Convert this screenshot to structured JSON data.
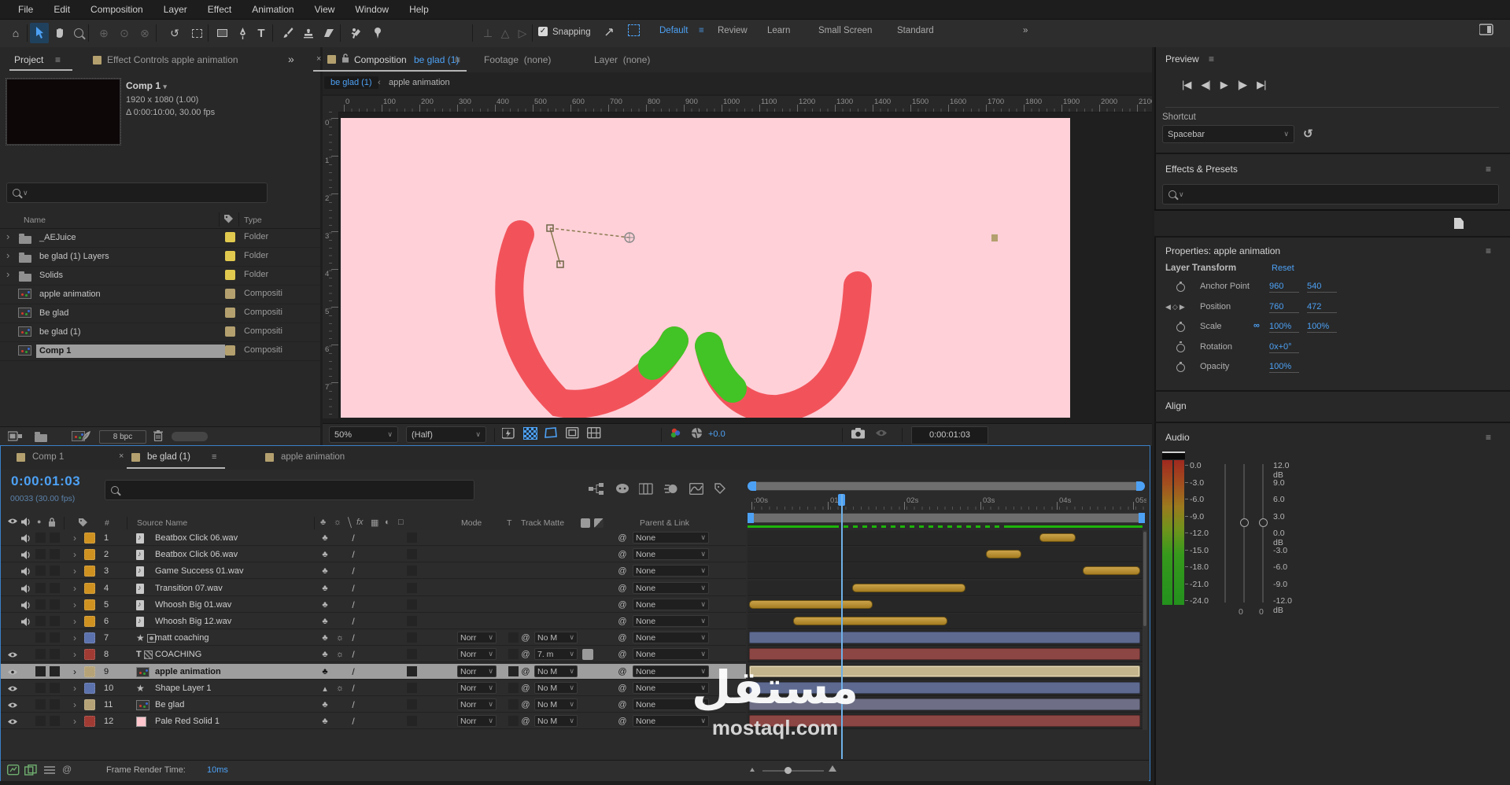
{
  "menu": {
    "items": [
      "File",
      "Edit",
      "Composition",
      "Layer",
      "Effect",
      "Animation",
      "View",
      "Window",
      "Help"
    ]
  },
  "toolbar": {
    "snapping": "Snapping",
    "workspaces": [
      "Default",
      "Review",
      "Learn",
      "Small Screen",
      "Standard"
    ]
  },
  "icons": {
    "home": "⌂",
    "hamburger": "≡",
    "chevrons": "»",
    "close": "×",
    "caret": "▾",
    "chev_down": "∨",
    "check": "✓",
    "reset": "↺",
    "rotate": "↺",
    "star": "★",
    "club": "♣",
    "sun": "☼",
    "slash": "/",
    "fx": "fx",
    "at": "@",
    "expand": "›",
    "crumb_sep": "‹",
    "link": "∞",
    "kf_left": "◀",
    "kf_diamond": "◇",
    "kf_right": "▶",
    "tr_first": "|◀",
    "tr_prev": "◀|",
    "tr_play": "▶",
    "tr_next": "|▶",
    "tr_last": "▶|",
    "solo": "●",
    "t_tool": "T",
    "film": "▦",
    "halfcircle": "◐",
    "cube": "□",
    "hash": "#",
    "delta": "Δ"
  },
  "project": {
    "tab_label": "Project",
    "effect_controls_label": "Effect Controls apple animation",
    "comp_name": "Comp 1",
    "comp_size": "1920 x 1080 (1.00)",
    "comp_duration": "Δ 0:00:10:00, 30.00 fps",
    "name_col": "Name",
    "type_col": "Type",
    "items": [
      {
        "name": "_AEJuice",
        "type": "Folder",
        "kind": "folder",
        "selected": false
      },
      {
        "name": "be glad (1) Layers",
        "type": "Folder",
        "kind": "folder",
        "selected": false
      },
      {
        "name": "Solids",
        "type": "Folder",
        "kind": "folder",
        "selected": false
      },
      {
        "name": "apple animation",
        "type": "Compositi",
        "kind": "comp",
        "selected": false
      },
      {
        "name": "Be glad",
        "type": "Compositi",
        "kind": "comp",
        "selected": false
      },
      {
        "name": "be glad (1)",
        "type": "Compositi",
        "kind": "comp",
        "selected": false
      },
      {
        "name": "Comp 1",
        "type": "Compositi",
        "kind": "comp",
        "selected": true
      }
    ],
    "bit_depth": "8 bpc"
  },
  "viewer": {
    "composition_label": "Composition",
    "comp_tab_name": "be glad (1)",
    "footage_label": "Footage",
    "footage_value": "(none)",
    "layer_label": "Layer",
    "layer_value": "(none)",
    "breadcrumb_current": "be glad (1)",
    "breadcrumb_parent": "apple animation",
    "h_ruler": [
      "0",
      "100",
      "200",
      "300",
      "400",
      "500",
      "600",
      "700",
      "800",
      "900",
      "1000",
      "1100",
      "1200",
      "1300",
      "1400",
      "1500",
      "1600",
      "1700",
      "1800",
      "1900",
      "2000",
      "2100"
    ],
    "v_ruler": [
      "0",
      "1",
      "2",
      "3",
      "4",
      "5",
      "6",
      "7"
    ],
    "zoom": "50%",
    "resolution": "(Half)",
    "exposure": "+0.0",
    "timecode": "0:00:01:03"
  },
  "preview": {
    "title": "Preview",
    "shortcut_label": "Shortcut",
    "shortcut_value": "Spacebar"
  },
  "effects": {
    "title": "Effects & Presets"
  },
  "properties": {
    "title": "Properties: apple animation",
    "section": "Layer Transform",
    "reset": "Reset",
    "rows": [
      {
        "label": "Anchor Point",
        "v1": "960",
        "v2": "540",
        "nav": false,
        "link": false
      },
      {
        "label": "Position",
        "v1": "760",
        "v2": "472",
        "nav": true,
        "link": false
      },
      {
        "label": "Scale",
        "v1": "100%",
        "v2": "100%",
        "nav": false,
        "link": true
      },
      {
        "label": "Rotation",
        "v1": "0x+0°",
        "v2": "",
        "nav": false,
        "link": false
      },
      {
        "label": "Opacity",
        "v1": "100%",
        "v2": "",
        "nav": false,
        "link": false
      }
    ]
  },
  "align": {
    "title": "Align"
  },
  "audio": {
    "title": "Audio",
    "left_scale": [
      "0.0",
      "-3.0",
      "-6.0",
      "-9.0",
      "-12.0",
      "-15.0",
      "-18.0",
      "-21.0",
      "-24.0"
    ],
    "right_scale": [
      "12.0 dB",
      "9.0",
      "6.0",
      "3.0",
      "0.0 dB",
      "-3.0",
      "-6.0",
      "-9.0",
      "-12.0 dB"
    ],
    "fader_values": [
      "0",
      "0"
    ]
  },
  "timeline": {
    "tabs": [
      {
        "label": "Comp 1",
        "active": false
      },
      {
        "label": "be glad (1)",
        "active": true
      },
      {
        "label": "apple animation",
        "active": false
      }
    ],
    "timecode": "0:00:01:03",
    "frames": "00033 (30.00 fps)",
    "source_name_col": "Source Name",
    "mode_col": "Mode",
    "t_col": "T",
    "matte_col": "Track Matte",
    "parent_col": "Parent & Link",
    "ruler_labels": [
      ":00s",
      "01s",
      "02s",
      "03s",
      "04s",
      "05s"
    ],
    "layers": [
      {
        "num": "1",
        "name": "Beatbox Click 06.wav",
        "kind": "audio",
        "label": "orange",
        "parent": "None",
        "bar": [
          3.8,
          4.28
        ]
      },
      {
        "num": "2",
        "name": "Beatbox Click 06.wav",
        "kind": "audio",
        "label": "orange",
        "parent": "None",
        "bar": [
          3.1,
          3.57
        ]
      },
      {
        "num": "3",
        "name": "Game Success 01.wav",
        "kind": "audio",
        "label": "orange",
        "parent": "None",
        "bar": [
          4.37,
          5.12
        ]
      },
      {
        "num": "4",
        "name": "Transition 07.wav",
        "kind": "audio",
        "label": "orange",
        "parent": "None",
        "bar": [
          1.35,
          2.84
        ]
      },
      {
        "num": "5",
        "name": "Whoosh Big 01.wav",
        "kind": "audio",
        "label": "orange",
        "parent": "None",
        "bar": [
          0.0,
          1.62
        ]
      },
      {
        "num": "6",
        "name": "Whoosh Big 12.wav",
        "kind": "audio",
        "label": "orange",
        "parent": "None",
        "bar": [
          0.58,
          2.6
        ]
      },
      {
        "num": "7",
        "name": "matt coaching",
        "kind": "shape-solid",
        "label": "blue",
        "video": false,
        "sun": true,
        "mode": "Norr",
        "matte": "No M",
        "parent": "None",
        "bar": [
          0,
          5.12
        ]
      },
      {
        "num": "8",
        "name": "COACHING",
        "kind": "text",
        "label": "red",
        "video": true,
        "sun": true,
        "mode": "Norr",
        "matte": "7. m",
        "matte_icon": true,
        "parent": "None",
        "bar": [
          0,
          5.12
        ]
      },
      {
        "num": "9",
        "name": "apple animation",
        "kind": "comp",
        "label": "sand",
        "video": true,
        "selected": true,
        "mode": "Norr",
        "matte": "No M",
        "parent": "None",
        "bar": [
          0,
          5.12
        ]
      },
      {
        "num": "10",
        "name": "Shape Layer 1",
        "kind": "shape",
        "label": "blue",
        "video": true,
        "sun": true,
        "flat": true,
        "mode": "Norr",
        "matte": "No M",
        "parent": "None",
        "bar": [
          0,
          5.12
        ]
      },
      {
        "num": "11",
        "name": "Be glad",
        "kind": "comp",
        "label": "sand",
        "video": true,
        "mode": "Norr",
        "matte": "No M",
        "parent": "None",
        "bar": [
          0,
          5.12
        ]
      },
      {
        "num": "12",
        "name": "Pale Red Solid 1",
        "kind": "solid",
        "label": "red",
        "video": true,
        "mode": "Norr",
        "matte": "No M",
        "parent": "None",
        "bar": [
          0,
          5.12
        ]
      }
    ],
    "frame_render_label": "Frame Render Time:",
    "frame_render_value": "10ms"
  },
  "watermark": {
    "word": "مستقل",
    "site": "mostaql.com"
  },
  "colors": {
    "accent_blue": "#4da1f5",
    "canvas_pink": "#ffd0d8",
    "shape_red": "#f2535b",
    "shape_green": "#42c326",
    "cache_green": "#1db50a",
    "label_orange": "#cf9221",
    "label_blue": "#5c72ad",
    "label_red": "#a03b33",
    "label_sand": "#b5a377",
    "bar_orange": "#b9882a",
    "bar_blue": "#5e6a90",
    "bar_red": "#8c4644",
    "bar_sand_selected": "#c4b58c"
  }
}
